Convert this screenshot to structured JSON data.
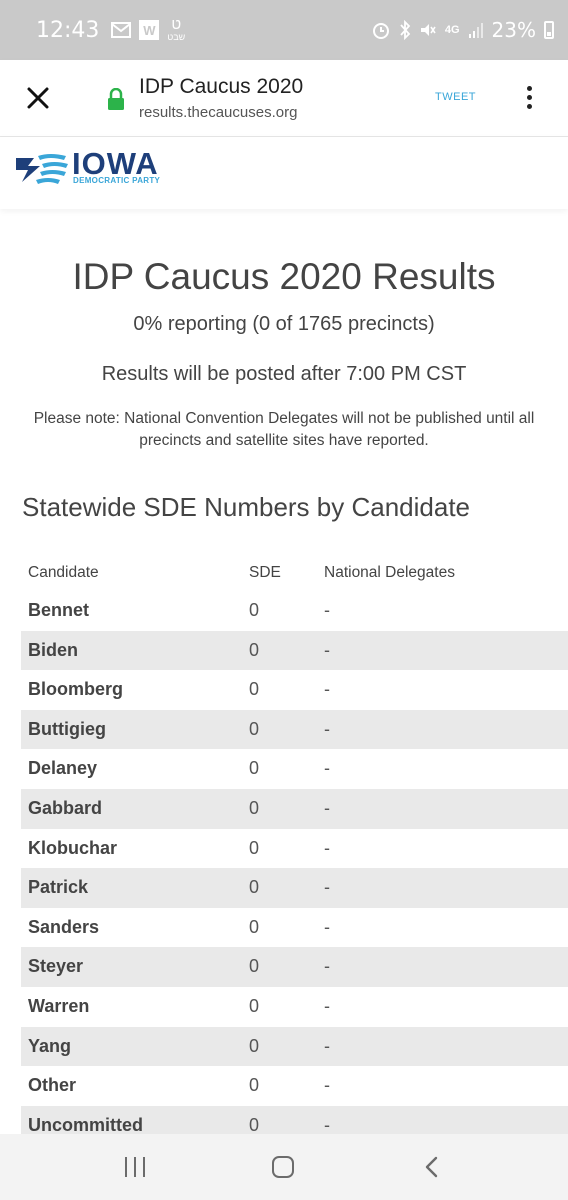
{
  "statusbar": {
    "time": "12:43",
    "hebrew_icon_top": "ט",
    "hebrew_icon_bottom": "שבט",
    "w_icon": "W",
    "network": "4G",
    "battery_pct": "23%"
  },
  "browser": {
    "title": "IDP Caucus 2020",
    "url": "results.thecaucuses.org",
    "tweet_label": "TWEET",
    "lock_color": "#2cb34a"
  },
  "logo": {
    "name": "IOWA",
    "subtitle": "DEMOCRATIC PARTY",
    "brand_color": "#1e3f7a",
    "accent_color": "#3aa6d8"
  },
  "page": {
    "title": "IDP Caucus 2020 Results",
    "reporting": "0% reporting (0 of 1765 precincts)",
    "posted": "Results will be posted after 7:00 PM CST",
    "note": "Please note: National Convention Delegates will not be published until all precincts and satellite sites have reported.",
    "section_title": "Statewide SDE Numbers by Candidate"
  },
  "table": {
    "headers": [
      "Candidate",
      "SDE",
      "National Delegates"
    ],
    "rows": [
      [
        "Bennet",
        "0",
        "-"
      ],
      [
        "Biden",
        "0",
        "-"
      ],
      [
        "Bloomberg",
        "0",
        "-"
      ],
      [
        "Buttigieg",
        "0",
        "-"
      ],
      [
        "Delaney",
        "0",
        "-"
      ],
      [
        "Gabbard",
        "0",
        "-"
      ],
      [
        "Klobuchar",
        "0",
        "-"
      ],
      [
        "Patrick",
        "0",
        "-"
      ],
      [
        "Sanders",
        "0",
        "-"
      ],
      [
        "Steyer",
        "0",
        "-"
      ],
      [
        "Warren",
        "0",
        "-"
      ],
      [
        "Yang",
        "0",
        "-"
      ],
      [
        "Other",
        "0",
        "-"
      ],
      [
        "Uncommitted",
        "0",
        "-"
      ]
    ]
  },
  "navbar": {
    "icons": [
      "recent-apps-icon",
      "home-icon",
      "back-icon"
    ]
  }
}
